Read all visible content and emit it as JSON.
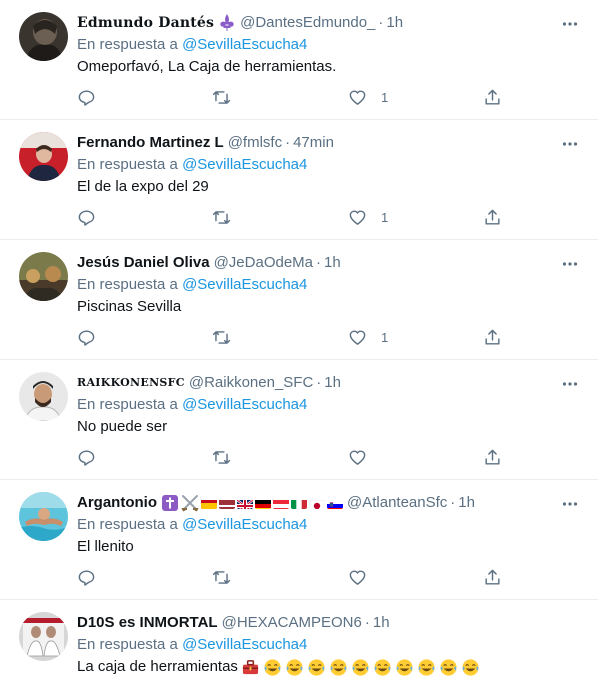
{
  "reply_prefix": "En respuesta a",
  "tweets": [
    {
      "name": "Edmundo Dantés",
      "handle": "@DantesEdmundo_",
      "time": "1h",
      "reply_to": "@SevillaEscucha4",
      "text": "Omeporfavó, La Caja de herramientas.",
      "likes": "1"
    },
    {
      "name": "Fernando Martinez L",
      "handle": "@fmlsfc",
      "time": "47min",
      "reply_to": "@SevillaEscucha4",
      "text": "El de la expo del 29",
      "likes": "1"
    },
    {
      "name": "Jesús Daniel Oliva",
      "handle": "@JeDaOdeMa",
      "time": "1h",
      "reply_to": "@SevillaEscucha4",
      "text": "Piscinas Sevilla",
      "likes": "1"
    },
    {
      "name": "RAIKKONENSFC",
      "handle": "@Raikkonen_SFC",
      "time": "1h",
      "reply_to": "@SevillaEscucha4",
      "text": "No puede ser",
      "likes": ""
    },
    {
      "name": "Argantonio",
      "handle": "@AtlanteanSfc",
      "time": "1h",
      "reply_to": "@SevillaEscucha4",
      "text": "El llenito",
      "likes": ""
    },
    {
      "name": "D10S es INMORTAL",
      "handle": "@HEXACAMPEON6",
      "time": "1h",
      "reply_to": "@SevillaEscucha4",
      "text": "La caja de herramientas",
      "likes": ""
    }
  ],
  "colors": {
    "text": "#0f1419",
    "secondary": "#5b7083",
    "link": "#1b95e0",
    "divider": "#ebeef0"
  }
}
